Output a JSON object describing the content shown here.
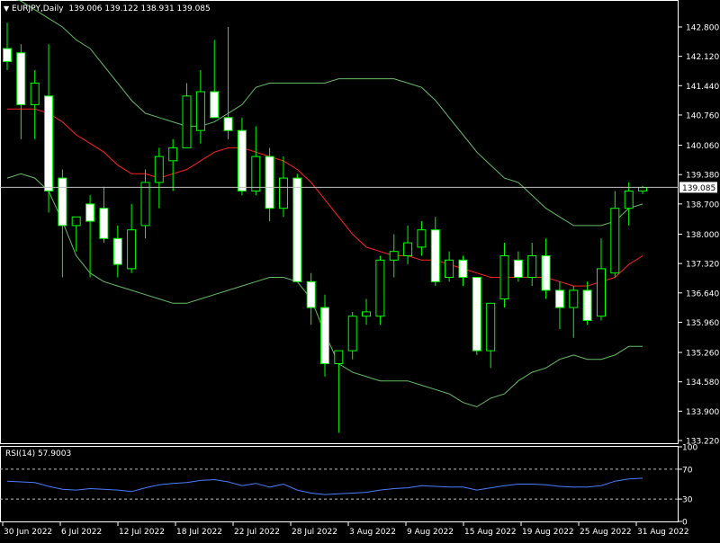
{
  "window": {
    "symbol_label": "EURJPY,Daily",
    "ohlc": "139.006 139.122 138.931 139.085",
    "current_price_tag": "139.085"
  },
  "colors": {
    "background": "#000000",
    "candle_up_fill": "#000000",
    "candle_down_fill": "#ffffff",
    "candle_outline": "#00ff00",
    "bollinger_band": "#66bb66",
    "moving_average": "#ff2222",
    "rsi_line": "#4a7cff",
    "level_line": "#c0c0c0"
  },
  "icons": {
    "dropdown": "triangle-down-icon"
  },
  "chart_data": [
    {
      "type": "candlestick",
      "title": "EURJPY,Daily",
      "price_axis_ticks": [
        "142.800",
        "142.120",
        "141.440",
        "140.760",
        "140.060",
        "139.380",
        "138.700",
        "138.000",
        "137.320",
        "136.640",
        "135.960",
        "135.260",
        "134.580",
        "133.900",
        "133.220"
      ],
      "ylim": [
        133.22,
        142.8
      ],
      "current_price": 139.085,
      "x_tick_labels": [
        "30 Jun 2022",
        "6 Jul 2022",
        "12 Jul 2022",
        "18 Jul 2022",
        "22 Jul 2022",
        "28 Jul 2022",
        "3 Aug 2022",
        "9 Aug 2022",
        "15 Aug 2022",
        "19 Aug 2022",
        "25 Aug 2022",
        "31 Aug 2022"
      ],
      "candles": [
        {
          "o": 142.3,
          "h": 142.9,
          "l": 141.8,
          "c": 142.0
        },
        {
          "o": 142.2,
          "h": 142.4,
          "l": 140.2,
          "c": 141.0
        },
        {
          "o": 141.0,
          "h": 141.8,
          "l": 140.2,
          "c": 141.5
        },
        {
          "o": 141.2,
          "h": 142.4,
          "l": 138.5,
          "c": 139.0
        },
        {
          "o": 139.3,
          "h": 139.5,
          "l": 137.0,
          "c": 138.2
        },
        {
          "o": 138.2,
          "h": 138.4,
          "l": 137.6,
          "c": 138.4
        },
        {
          "o": 138.7,
          "h": 138.9,
          "l": 137.0,
          "c": 138.3
        },
        {
          "o": 138.6,
          "h": 139.1,
          "l": 137.8,
          "c": 137.9
        },
        {
          "o": 137.9,
          "h": 138.2,
          "l": 137.0,
          "c": 137.3
        },
        {
          "o": 137.2,
          "h": 138.7,
          "l": 137.1,
          "c": 138.1
        },
        {
          "o": 138.2,
          "h": 139.5,
          "l": 137.9,
          "c": 139.2
        },
        {
          "o": 139.2,
          "h": 140.0,
          "l": 138.6,
          "c": 139.8
        },
        {
          "o": 139.7,
          "h": 140.2,
          "l": 139.0,
          "c": 140.0
        },
        {
          "o": 140.0,
          "h": 141.5,
          "l": 140.0,
          "c": 141.2
        },
        {
          "o": 140.4,
          "h": 141.8,
          "l": 140.1,
          "c": 141.3
        },
        {
          "o": 141.3,
          "h": 142.5,
          "l": 140.7,
          "c": 140.7
        },
        {
          "o": 140.7,
          "h": 142.8,
          "l": 140.2,
          "c": 140.4
        },
        {
          "o": 140.4,
          "h": 140.7,
          "l": 138.9,
          "c": 139.0
        },
        {
          "o": 139.0,
          "h": 140.5,
          "l": 138.9,
          "c": 139.8
        },
        {
          "o": 139.8,
          "h": 140.0,
          "l": 138.3,
          "c": 138.6
        },
        {
          "o": 138.6,
          "h": 139.8,
          "l": 138.4,
          "c": 139.3
        },
        {
          "o": 139.3,
          "h": 139.4,
          "l": 136.9,
          "c": 136.9
        },
        {
          "o": 136.9,
          "h": 137.1,
          "l": 135.9,
          "c": 136.3
        },
        {
          "o": 136.3,
          "h": 136.6,
          "l": 134.7,
          "c": 135.0
        },
        {
          "o": 135.0,
          "h": 135.2,
          "l": 133.4,
          "c": 135.3
        },
        {
          "o": 135.3,
          "h": 136.2,
          "l": 135.1,
          "c": 136.1
        },
        {
          "o": 136.1,
          "h": 136.5,
          "l": 135.9,
          "c": 136.2
        },
        {
          "o": 136.1,
          "h": 137.5,
          "l": 135.9,
          "c": 137.4
        },
        {
          "o": 137.4,
          "h": 138.0,
          "l": 137.0,
          "c": 137.6
        },
        {
          "o": 137.5,
          "h": 138.2,
          "l": 137.3,
          "c": 137.8
        },
        {
          "o": 137.7,
          "h": 138.3,
          "l": 137.5,
          "c": 138.1
        },
        {
          "o": 138.1,
          "h": 138.4,
          "l": 136.8,
          "c": 136.9
        },
        {
          "o": 137.0,
          "h": 137.6,
          "l": 136.9,
          "c": 137.4
        },
        {
          "o": 137.4,
          "h": 137.5,
          "l": 136.8,
          "c": 137.0
        },
        {
          "o": 137.0,
          "h": 137.0,
          "l": 135.2,
          "c": 135.3
        },
        {
          "o": 135.3,
          "h": 136.4,
          "l": 134.9,
          "c": 136.4
        },
        {
          "o": 136.5,
          "h": 137.8,
          "l": 136.3,
          "c": 137.5
        },
        {
          "o": 137.4,
          "h": 137.6,
          "l": 136.9,
          "c": 137.0
        },
        {
          "o": 137.0,
          "h": 137.8,
          "l": 136.8,
          "c": 137.5
        },
        {
          "o": 137.5,
          "h": 137.9,
          "l": 136.5,
          "c": 136.7
        },
        {
          "o": 136.7,
          "h": 136.9,
          "l": 135.8,
          "c": 136.3
        },
        {
          "o": 136.3,
          "h": 136.8,
          "l": 135.6,
          "c": 136.7
        },
        {
          "o": 136.7,
          "h": 136.9,
          "l": 135.9,
          "c": 136.0
        },
        {
          "o": 136.1,
          "h": 137.9,
          "l": 136.0,
          "c": 137.2
        },
        {
          "o": 137.1,
          "h": 139.0,
          "l": 137.0,
          "c": 138.6
        },
        {
          "o": 138.6,
          "h": 139.2,
          "l": 138.2,
          "c": 139.0
        },
        {
          "o": 139.0,
          "h": 139.12,
          "l": 138.93,
          "c": 139.08
        }
      ],
      "moving_average": [
        140.9,
        140.9,
        140.9,
        140.8,
        140.6,
        140.3,
        140.1,
        139.9,
        139.6,
        139.4,
        139.4,
        139.3,
        139.4,
        139.5,
        139.7,
        139.9,
        140.0,
        140.0,
        139.9,
        139.8,
        139.7,
        139.5,
        139.2,
        138.8,
        138.4,
        138.0,
        137.7,
        137.6,
        137.5,
        137.5,
        137.4,
        137.4,
        137.3,
        137.2,
        137.1,
        137.0,
        137.0,
        137.0,
        137.0,
        137.0,
        136.9,
        136.8,
        136.8,
        136.9,
        137.0,
        137.3,
        137.5
      ],
      "bollinger_upper": [
        143.5,
        143.4,
        143.2,
        143.0,
        142.8,
        142.5,
        142.3,
        141.9,
        141.5,
        141.1,
        140.8,
        140.7,
        140.6,
        140.5,
        140.5,
        140.6,
        140.8,
        141.0,
        141.4,
        141.5,
        141.5,
        141.5,
        141.5,
        141.5,
        141.6,
        141.6,
        141.6,
        141.6,
        141.6,
        141.5,
        141.4,
        141.1,
        140.7,
        140.3,
        139.9,
        139.6,
        139.3,
        139.2,
        138.9,
        138.6,
        138.4,
        138.2,
        138.2,
        138.2,
        138.3,
        138.6,
        138.7
      ],
      "bollinger_lower": [
        139.3,
        139.4,
        139.3,
        139.0,
        138.3,
        137.5,
        137.1,
        136.9,
        136.8,
        136.7,
        136.6,
        136.5,
        136.4,
        136.4,
        136.5,
        136.6,
        136.7,
        136.8,
        136.9,
        137.0,
        137.0,
        136.9,
        136.5,
        135.7,
        135.0,
        134.8,
        134.7,
        134.6,
        134.6,
        134.6,
        134.5,
        134.4,
        134.3,
        134.1,
        134.0,
        134.2,
        134.3,
        134.6,
        134.8,
        134.9,
        135.1,
        135.2,
        135.1,
        135.1,
        135.2,
        135.4,
        135.4
      ]
    },
    {
      "type": "line",
      "title": "RSI(14) 57.9003",
      "levels": [
        70,
        30
      ],
      "tick_labels": [
        "100",
        "70",
        "30",
        "0"
      ],
      "ylim": [
        0,
        100
      ],
      "series": [
        {
          "values": [
            54,
            53,
            52,
            47,
            43,
            42,
            44,
            43,
            42,
            40,
            45,
            49,
            51,
            52,
            55,
            56,
            53,
            48,
            51,
            46,
            50,
            42,
            38,
            36,
            37,
            38,
            39,
            42,
            44,
            45,
            48,
            47,
            46,
            46,
            42,
            45,
            48,
            50,
            50,
            49,
            47,
            46,
            46,
            48,
            54,
            57,
            58
          ]
        }
      ]
    }
  ]
}
